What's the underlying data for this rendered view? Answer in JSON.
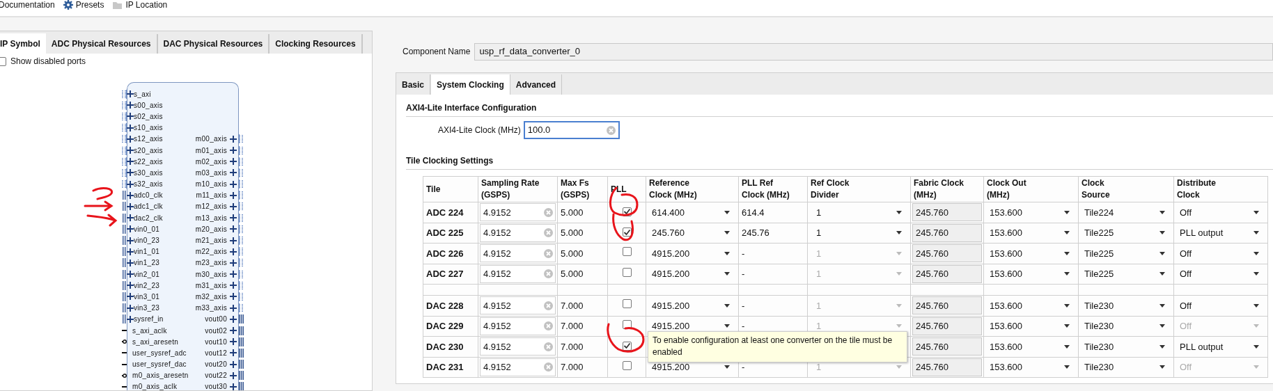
{
  "toolbar": [
    {
      "kind": "text",
      "label": "Documentation"
    },
    {
      "kind": "gear",
      "label": "Presets"
    },
    {
      "kind": "folder",
      "label": "IP Location"
    }
  ],
  "left_panel": {
    "tabs": [
      {
        "label": "IP Symbol",
        "selected": true
      },
      {
        "label": "ADC Physical Resources",
        "selected": false
      },
      {
        "label": "DAC Physical Resources",
        "selected": false
      },
      {
        "label": "Clocking Resources",
        "selected": false
      }
    ],
    "show_disabled_ports": {
      "label": "Show disabled ports",
      "checked": false
    },
    "symbol": {
      "ports_left": [
        {
          "name": "s_axi",
          "kind": "bus"
        },
        {
          "name": "s00_axis",
          "kind": "bus"
        },
        {
          "name": "s02_axis",
          "kind": "bus"
        },
        {
          "name": "s10_axis",
          "kind": "bus"
        },
        {
          "name": "s12_axis",
          "kind": "bus"
        },
        {
          "name": "s20_axis",
          "kind": "bus"
        },
        {
          "name": "s22_axis",
          "kind": "bus"
        },
        {
          "name": "s30_axis",
          "kind": "bus"
        },
        {
          "name": "s32_axis",
          "kind": "bus"
        },
        {
          "name": "adc0_clk",
          "kind": "diff"
        },
        {
          "name": "adc1_clk",
          "kind": "diff"
        },
        {
          "name": "dac2_clk",
          "kind": "diff"
        },
        {
          "name": "vin0_01",
          "kind": "diff"
        },
        {
          "name": "vin0_23",
          "kind": "diff"
        },
        {
          "name": "vin1_01",
          "kind": "diff"
        },
        {
          "name": "vin1_23",
          "kind": "diff"
        },
        {
          "name": "vin2_01",
          "kind": "diff"
        },
        {
          "name": "vin2_23",
          "kind": "diff"
        },
        {
          "name": "vin3_01",
          "kind": "diff"
        },
        {
          "name": "vin3_23",
          "kind": "diff"
        },
        {
          "name": "sysref_in",
          "kind": "diff"
        },
        {
          "name": "s_axi_aclk",
          "kind": "wire"
        },
        {
          "name": "s_axi_aresetn",
          "kind": "inverted"
        },
        {
          "name": "user_sysref_adc",
          "kind": "wire"
        },
        {
          "name": "user_sysref_dac",
          "kind": "wire"
        },
        {
          "name": "m0_axis_aresetn",
          "kind": "inverted"
        },
        {
          "name": "m0_axis_aclk",
          "kind": "wire"
        }
      ],
      "ports_right": [
        {
          "name": "m00_axis",
          "kind": "bus"
        },
        {
          "name": "m01_axis",
          "kind": "bus"
        },
        {
          "name": "m02_axis",
          "kind": "bus"
        },
        {
          "name": "m03_axis",
          "kind": "bus"
        },
        {
          "name": "m10_axis",
          "kind": "bus"
        },
        {
          "name": "m11_axis",
          "kind": "bus"
        },
        {
          "name": "m12_axis",
          "kind": "bus"
        },
        {
          "name": "m13_axis",
          "kind": "bus"
        },
        {
          "name": "m20_axis",
          "kind": "bus"
        },
        {
          "name": "m21_axis",
          "kind": "bus"
        },
        {
          "name": "m22_axis",
          "kind": "bus"
        },
        {
          "name": "m23_axis",
          "kind": "bus"
        },
        {
          "name": "m30_axis",
          "kind": "bus"
        },
        {
          "name": "m31_axis",
          "kind": "bus"
        },
        {
          "name": "m32_axis",
          "kind": "bus"
        },
        {
          "name": "m33_axis",
          "kind": "bus"
        },
        {
          "name": "vout00",
          "kind": "diff"
        },
        {
          "name": "vout02",
          "kind": "diff"
        },
        {
          "name": "vout10",
          "kind": "diff"
        },
        {
          "name": "vout12",
          "kind": "diff"
        },
        {
          "name": "vout20",
          "kind": "diff"
        },
        {
          "name": "vout22",
          "kind": "diff"
        },
        {
          "name": "vout30",
          "kind": "diff"
        }
      ]
    }
  },
  "component_name": {
    "label": "Component Name",
    "value": "usp_rf_data_converter_0"
  },
  "tabs": [
    {
      "label": "Basic",
      "selected": false
    },
    {
      "label": "System Clocking",
      "selected": true
    },
    {
      "label": "Advanced",
      "selected": false
    }
  ],
  "axi_section": {
    "title": "AXI4-Lite Interface Configuration",
    "field": {
      "label": "AXI4-Lite Clock (MHz)",
      "value": "100.0"
    }
  },
  "tile_section": {
    "title": "Tile Clocking Settings",
    "columns": [
      [
        "Tile"
      ],
      [
        "Sampling Rate",
        "(GSPS)"
      ],
      [
        "Max Fs",
        "(GSPS)"
      ],
      [
        "PLL"
      ],
      [
        "Reference",
        "Clock (MHz)"
      ],
      [
        "PLL Ref",
        "Clock (MHz)"
      ],
      [
        "Ref Clock",
        "Divider"
      ],
      [
        "Fabric Clock",
        "(MHz)"
      ],
      [
        "Clock Out",
        "(MHz)"
      ],
      [
        "Clock",
        "Source"
      ],
      [
        "Distribute",
        "Clock"
      ]
    ],
    "rows": [
      {
        "kind": "tile",
        "tile": "ADC 224",
        "sampling_rate": "4.9152",
        "max_fs": "5.000",
        "pll": true,
        "ref_clock": "614.400",
        "pll_ref_clock": "614.4",
        "ref_divider": "1",
        "ref_divider_disabled": false,
        "fabric_clock": "245.760",
        "clock_out": "153.600",
        "clock_source": "Tile224",
        "distribute": "Off",
        "distribute_disabled": false
      },
      {
        "kind": "tile",
        "tile": "ADC 225",
        "sampling_rate": "4.9152",
        "max_fs": "5.000",
        "pll": true,
        "ref_clock": "245.760",
        "pll_ref_clock": "245.76",
        "ref_divider": "1",
        "ref_divider_disabled": false,
        "fabric_clock": "245.760",
        "clock_out": "153.600",
        "clock_source": "Tile225",
        "distribute": "PLL output",
        "distribute_disabled": false
      },
      {
        "kind": "tile",
        "tile": "ADC 226",
        "sampling_rate": "4.9152",
        "max_fs": "5.000",
        "pll": false,
        "ref_clock": "4915.200",
        "pll_ref_clock": "-",
        "ref_divider": "1",
        "ref_divider_disabled": true,
        "fabric_clock": "245.760",
        "clock_out": "153.600",
        "clock_source": "Tile225",
        "distribute": "Off",
        "distribute_disabled": false
      },
      {
        "kind": "tile",
        "tile": "ADC 227",
        "sampling_rate": "4.9152",
        "max_fs": "5.000",
        "pll": false,
        "ref_clock": "4915.200",
        "pll_ref_clock": "-",
        "ref_divider": "1",
        "ref_divider_disabled": true,
        "fabric_clock": "245.760",
        "clock_out": "153.600",
        "clock_source": "Tile225",
        "distribute": "Off",
        "distribute_disabled": false
      },
      {
        "kind": "spacer"
      },
      {
        "kind": "tile",
        "tile": "DAC 228",
        "sampling_rate": "4.9152",
        "max_fs": "7.000",
        "pll": false,
        "ref_clock": "4915.200",
        "pll_ref_clock": "-",
        "ref_divider": "1",
        "ref_divider_disabled": true,
        "fabric_clock": "245.760",
        "clock_out": "153.600",
        "clock_source": "Tile230",
        "distribute": "Off",
        "distribute_disabled": false
      },
      {
        "kind": "tile",
        "tile": "DAC 229",
        "sampling_rate": "4.9152",
        "max_fs": "7.000",
        "pll": false,
        "ref_clock": "4915.200",
        "pll_ref_clock": "-",
        "ref_divider": "1",
        "ref_divider_disabled": true,
        "fabric_clock": "245.760",
        "clock_out": "153.600",
        "clock_source": "Tile230",
        "distribute": "Off",
        "distribute_disabled": true
      },
      {
        "kind": "tile",
        "tile": "DAC 230",
        "sampling_rate": "4.9152",
        "max_fs": "7.000",
        "pll": true,
        "fabric_clock": "245.760",
        "clock_out": "153.600",
        "clock_source": "Tile230",
        "distribute": "PLL output",
        "distribute_disabled": false
      },
      {
        "kind": "tile",
        "tile": "DAC 231",
        "sampling_rate": "4.9152",
        "max_fs": "7.000",
        "pll": false,
        "ref_clock": "4915.200",
        "pll_ref_clock": "-",
        "ref_divider": "1",
        "ref_divider_disabled": true,
        "fabric_clock": "245.760",
        "clock_out": "153.600",
        "clock_source": "Tile230",
        "distribute": "Off",
        "distribute_disabled": true
      }
    ],
    "tooltip": "To enable configuration at least one converter on the tile must be enabled"
  }
}
